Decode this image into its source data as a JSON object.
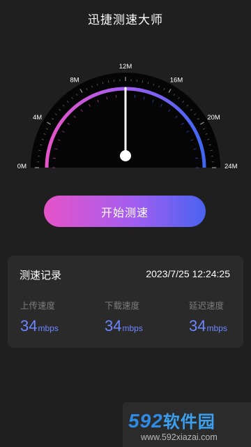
{
  "header": {
    "title": "迅捷测速大师"
  },
  "gauge": {
    "tick_labels": [
      "0M",
      "4M",
      "8M",
      "12M",
      "16M",
      "20M",
      "24M"
    ],
    "min": 0,
    "max": 24,
    "needle_value": 12,
    "colors": {
      "start": "#e653c8",
      "mid": "#a35ef0",
      "end": "#3e66f2"
    }
  },
  "actions": {
    "start_button_label": "开始测速"
  },
  "record": {
    "title": "测速记录",
    "timestamp": "2023/7/25 12:24:25",
    "upload": {
      "label": "上传速度",
      "value": "34",
      "unit": "mbps"
    },
    "download": {
      "label": "下载速度",
      "value": "34",
      "unit": "mbps"
    },
    "delay": {
      "label": "延迟速度",
      "value": "34",
      "unit": "mbps"
    }
  },
  "watermark": {
    "digits": "592",
    "text": "软件园",
    "url": "www.592xiazai.com"
  },
  "theme": {
    "accent": "#6e86ff",
    "background": "#1f1f1f",
    "card": "#2a2a2a"
  }
}
